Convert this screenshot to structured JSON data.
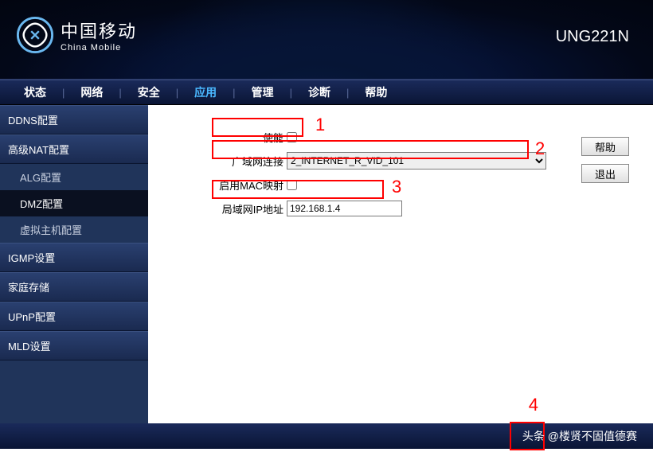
{
  "header": {
    "brand_cn": "中国移动",
    "brand_en": "China Mobile",
    "model": "UNG221N"
  },
  "nav": {
    "items": [
      "状态",
      "网络",
      "安全",
      "应用",
      "管理",
      "诊断",
      "帮助"
    ],
    "active_index": 3
  },
  "sidebar": {
    "groups": [
      {
        "label": "DDNS配置",
        "subs": []
      },
      {
        "label": "高级NAT配置",
        "subs": [
          {
            "label": "ALG配置",
            "active": false
          },
          {
            "label": "DMZ配置",
            "active": true
          },
          {
            "label": "虚拟主机配置",
            "active": false
          }
        ]
      },
      {
        "label": "IGMP设置",
        "subs": []
      },
      {
        "label": "家庭存储",
        "subs": []
      },
      {
        "label": "UPnP配置",
        "subs": []
      },
      {
        "label": "MLD设置",
        "subs": []
      }
    ]
  },
  "form": {
    "enable_label": "使能",
    "enable_value": false,
    "wan_label": "广域网连接",
    "wan_value": "2_INTERNET_R_VID_101",
    "mac_label": "启用MAC映射",
    "mac_value": false,
    "lan_ip_label": "局域网IP地址",
    "lan_ip_value": "192.168.1.4"
  },
  "annotations": {
    "n1": "1",
    "n2": "2",
    "n3": "3",
    "n4": "4"
  },
  "buttons": {
    "help": "帮助",
    "exit": "退出"
  },
  "footer": {
    "watermark": "头条 @楼贤不固值德赛"
  }
}
